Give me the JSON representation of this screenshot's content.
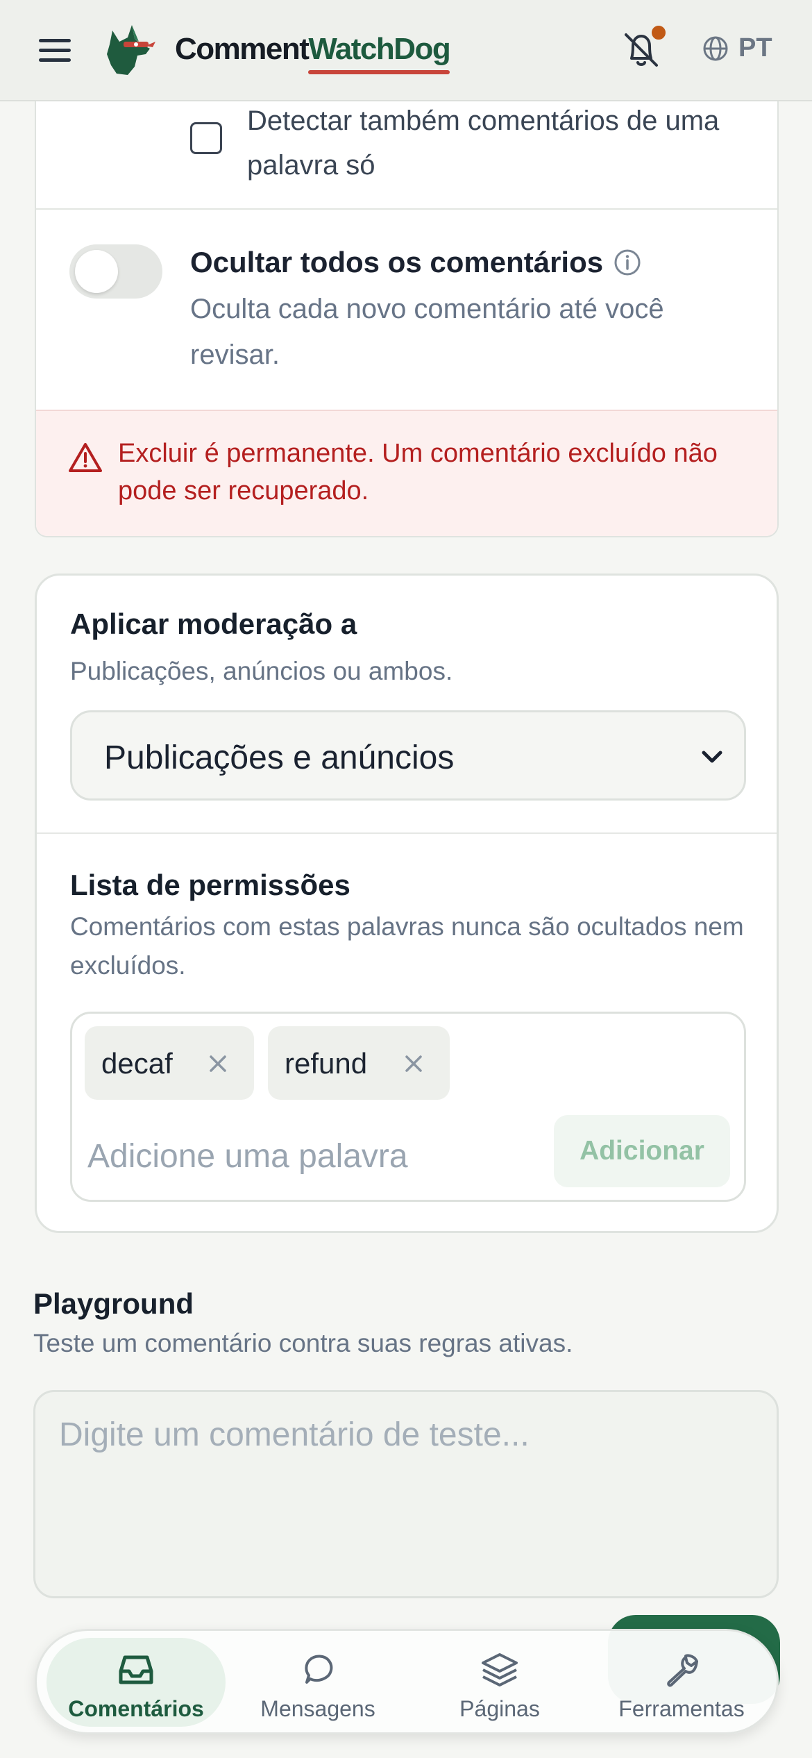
{
  "header": {
    "brand_part1": "Comment",
    "brand_part2": "WatchDog",
    "language": "PT",
    "notification_dot_color": "#c15a16"
  },
  "settings": {
    "single_word_checkbox_label": "Detectar também comentários de uma palavra só",
    "single_word_checked": false,
    "hide_all": {
      "title": "Ocultar todos os comentários",
      "description": "Oculta cada novo comentário até você revisar.",
      "enabled": false
    },
    "warning": "Excluir é permanente. Um comentário excluído não pode ser recuperado."
  },
  "moderation": {
    "title": "Aplicar moderação a",
    "subtitle": "Publicações, anúncios ou ambos.",
    "selected": "Publicações e anúncios"
  },
  "allowlist": {
    "title": "Lista de permissões",
    "subtitle": "Comentários com estas palavras nunca são ocultados nem excluídos.",
    "tags": [
      "decaf",
      "refund"
    ],
    "input_placeholder": "Adicione uma palavra",
    "add_label": "Adicionar"
  },
  "playground": {
    "title": "Playground",
    "subtitle": "Teste um comentário contra suas regras ativas.",
    "placeholder": "Digite um comentário de teste..."
  },
  "bottom_nav": {
    "items": [
      {
        "label": "Comentários",
        "icon": "inbox-icon",
        "active": true
      },
      {
        "label": "Mensagens",
        "icon": "chat-bubble-icon",
        "active": false
      },
      {
        "label": "Páginas",
        "icon": "layers-icon",
        "active": false
      },
      {
        "label": "Ferramentas",
        "icon": "wrench-icon",
        "active": false
      }
    ]
  },
  "colors": {
    "brand_green": "#1d5a3e",
    "brand_underline": "#c8453a",
    "warning_red": "#b41f1f",
    "accent_green": "#236b47"
  }
}
